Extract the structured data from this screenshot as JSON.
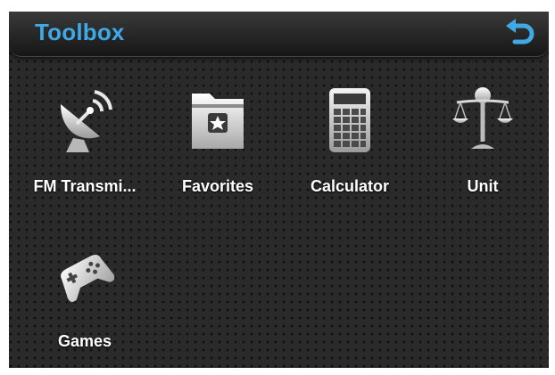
{
  "window": {
    "title": "Toolbox",
    "accent_color": "#3fa9e6",
    "back_icon": "return-arrow-icon"
  },
  "apps": [
    {
      "label": "FM Transmi...",
      "icon": "satellite-dish-icon"
    },
    {
      "label": "Favorites",
      "icon": "star-folder-icon"
    },
    {
      "label": "Calculator",
      "icon": "calculator-icon"
    },
    {
      "label": "Unit",
      "icon": "balance-scale-icon"
    },
    {
      "label": "Games",
      "icon": "gamepad-icon"
    }
  ]
}
